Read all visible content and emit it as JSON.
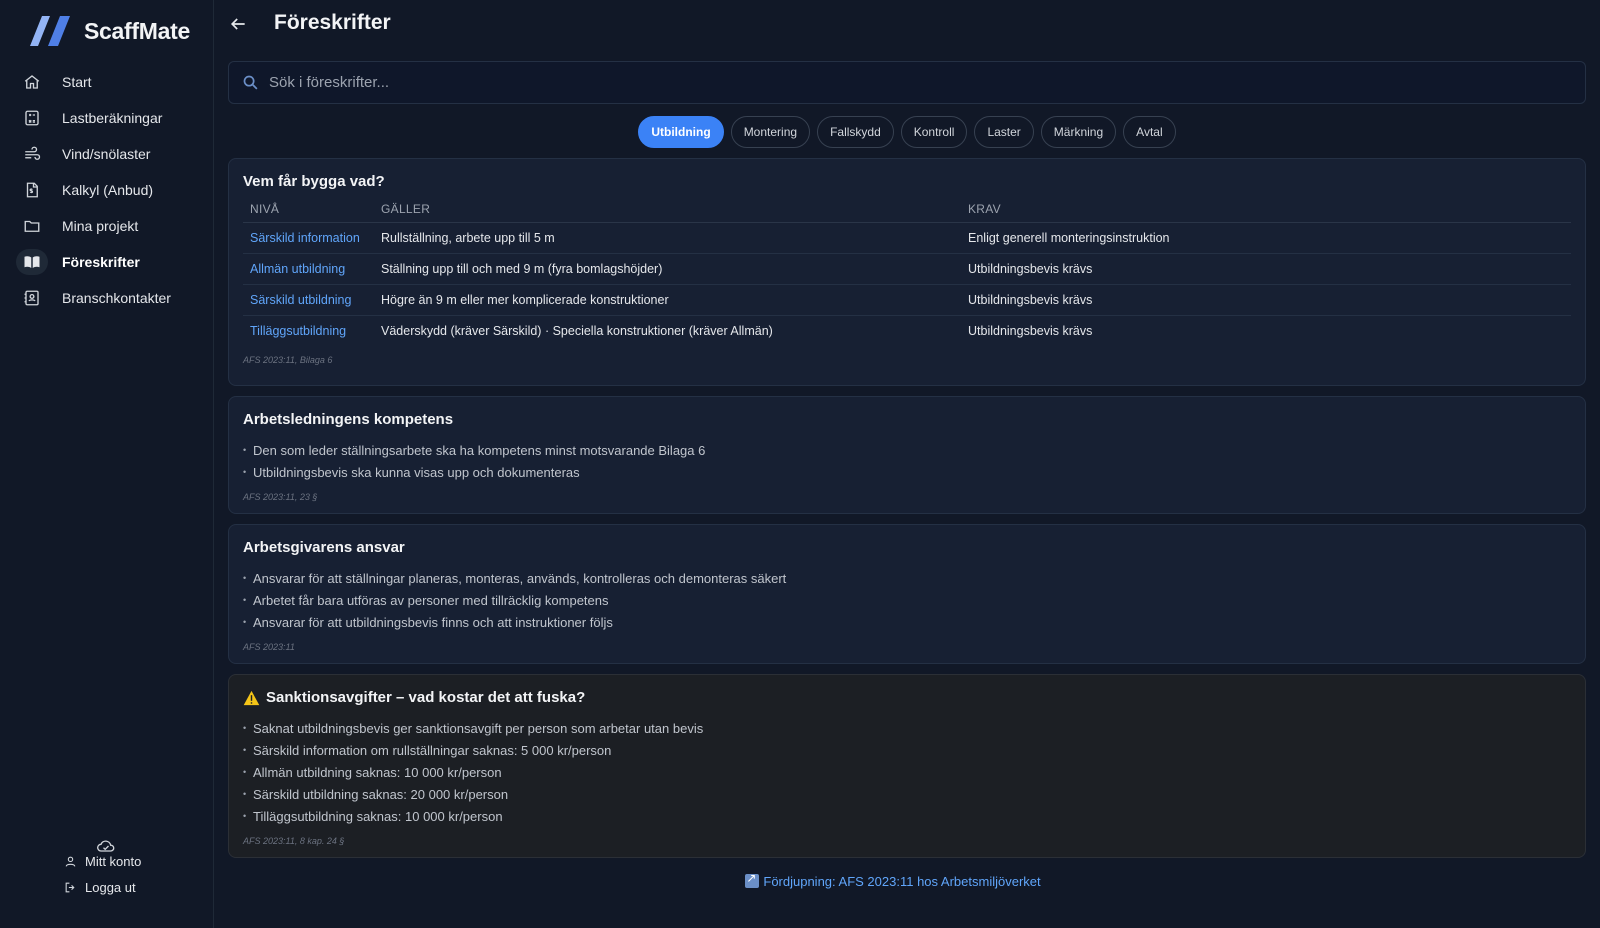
{
  "app": {
    "name": "ScaffMate"
  },
  "sidebar": {
    "items": [
      {
        "label": "Start",
        "icon": "home-icon",
        "active": false
      },
      {
        "label": "Lastberäkningar",
        "icon": "calculator-icon",
        "active": false
      },
      {
        "label": "Vind/snölaster",
        "icon": "wind-icon",
        "active": false
      },
      {
        "label": "Kalkyl (Anbud)",
        "icon": "invoice-icon",
        "active": false
      },
      {
        "label": "Mina projekt",
        "icon": "folder-icon",
        "active": false
      },
      {
        "label": "Föreskrifter",
        "icon": "book-icon",
        "active": true
      },
      {
        "label": "Branschkontakter",
        "icon": "contacts-icon",
        "active": false
      }
    ],
    "account_label": "Mitt konto",
    "logout_label": "Logga ut"
  },
  "header": {
    "title": "Föreskrifter"
  },
  "search": {
    "placeholder": "Sök i föreskrifter..."
  },
  "tabs": [
    {
      "label": "Utbildning",
      "active": true
    },
    {
      "label": "Montering",
      "active": false
    },
    {
      "label": "Fallskydd",
      "active": false
    },
    {
      "label": "Kontroll",
      "active": false
    },
    {
      "label": "Laster",
      "active": false
    },
    {
      "label": "Märkning",
      "active": false
    },
    {
      "label": "Avtal",
      "active": false
    }
  ],
  "table_card": {
    "title": "Vem får bygga vad?",
    "columns": [
      "NIVÅ",
      "GÄLLER",
      "KRAV"
    ],
    "rows": [
      [
        "Särskild information",
        "Rullställning, arbete upp till 5 m",
        "Enligt generell monteringsinstruktion"
      ],
      [
        "Allmän utbildning",
        "Ställning upp till och med 9 m (fyra bomlagshöjder)",
        "Utbildningsbevis krävs"
      ],
      [
        "Särskild utbildning",
        "Högre än 9 m eller mer komplicerade konstruktioner",
        "Utbildningsbevis krävs"
      ],
      [
        "Tilläggsutbildning",
        "Väderskydd (kräver Särskild) · Speciella konstruktioner (kräver Allmän)",
        "Utbildningsbevis krävs"
      ]
    ],
    "source": "AFS 2023:11, Bilaga 6"
  },
  "cards": [
    {
      "title": "Arbetsledningens kompetens",
      "bullets": [
        "Den som leder ställningsarbete ska ha kompetens minst motsvarande Bilaga 6",
        "Utbildningsbevis ska kunna visas upp och dokumenteras"
      ],
      "source": "AFS 2023:11, 23 §"
    },
    {
      "title": "Arbetsgivarens ansvar",
      "bullets": [
        "Ansvarar för att ställningar planeras, monteras, används, kontrolleras och demonteras säkert",
        "Arbetet får bara utföras av personer med tillräcklig kompetens",
        "Ansvarar för att utbildningsbevis finns och att instruktioner följs"
      ],
      "source": "AFS 2023:11"
    },
    {
      "title": "Sanktionsavgifter – vad kostar det att fuska?",
      "warning": true,
      "bullets": [
        "Saknat utbildningsbevis ger sanktionsavgift per person som arbetar utan bevis",
        "Särskild information om rullställningar saknas: 5 000 kr/person",
        "Allmän utbildning saknas: 10 000 kr/person",
        "Särskild utbildning saknas: 20 000 kr/person",
        "Tilläggsutbildning saknas: 10 000 kr/person"
      ],
      "source": "AFS 2023:11, 8 kap. 24 §"
    }
  ],
  "footer": {
    "link_label": "Fördjupning: AFS 2023:11 hos Arbetsmiljöverket"
  },
  "colors": {
    "accent": "#3b82f6",
    "link": "#60a5fa",
    "background": "#111827",
    "card": "#172033"
  }
}
